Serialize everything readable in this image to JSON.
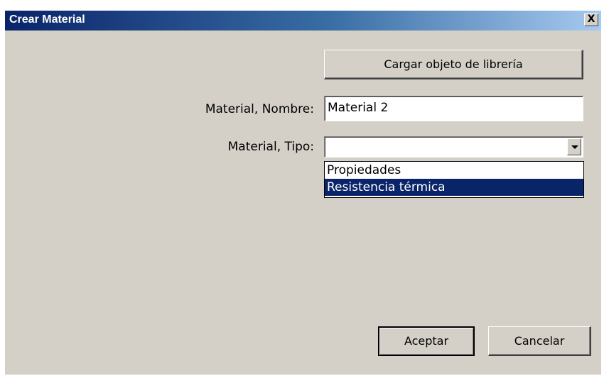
{
  "window": {
    "title": "Crear Material",
    "close_label": "X"
  },
  "load_library_button": "Cargar objeto de librería",
  "name_field": {
    "label": "Material, Nombre:",
    "value": "Material 2"
  },
  "type_field": {
    "label": "Material, Tipo:",
    "value": "",
    "options": [
      "Propiedades",
      "Resistencia térmica"
    ],
    "highlighted_option": "Resistencia térmica"
  },
  "footer": {
    "ok_label": "Aceptar",
    "cancel_label": "Cancelar"
  },
  "colors": {
    "titlebar_start": "#0a246a",
    "titlebar_end": "#a6caf0",
    "dialog_bg": "#d4d0c8",
    "selection": "#0a246a"
  }
}
